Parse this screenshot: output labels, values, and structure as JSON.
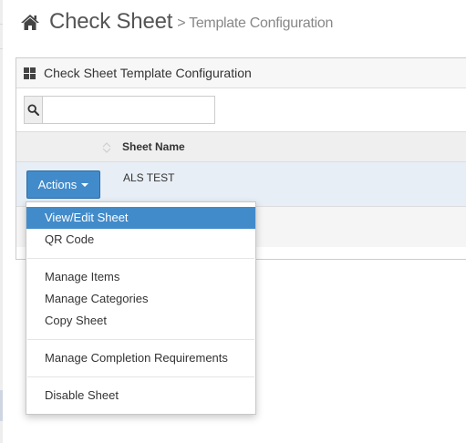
{
  "header": {
    "title": "Check Sheet",
    "subtitle": "> Template Configuration"
  },
  "widget": {
    "title": "Check Sheet Template Configuration",
    "search": {
      "value": "",
      "placeholder": ""
    }
  },
  "table": {
    "columns": [
      "Sheet Name"
    ],
    "rows": [
      {
        "sheet_name": "ALS TEST"
      }
    ]
  },
  "actions_button": {
    "label": "Actions"
  },
  "menu": {
    "items": [
      {
        "label": "View/Edit Sheet",
        "active": true
      },
      {
        "label": "QR Code"
      },
      {
        "label": "Manage Items"
      },
      {
        "label": "Manage Categories"
      },
      {
        "label": "Copy Sheet"
      },
      {
        "label": "Manage Completion Requirements"
      },
      {
        "label": "Disable Sheet"
      }
    ]
  },
  "icons": {
    "home": "home-icon",
    "grid": "grid-icon",
    "search": "search-icon",
    "sort": "sort-icon",
    "caret": "caret-down-icon"
  },
  "colors": {
    "primary": "#428bca",
    "row_highlight": "#e8eef6",
    "header_bg": "#f7f7f7"
  }
}
